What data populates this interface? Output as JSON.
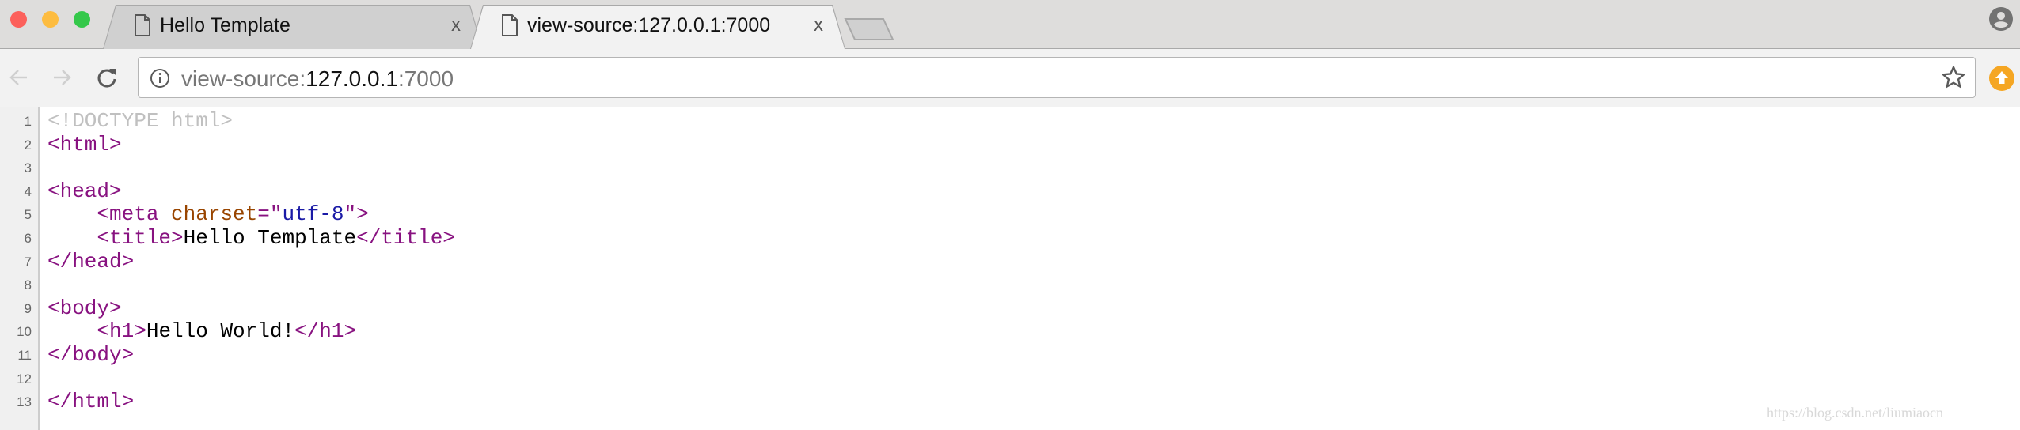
{
  "window": {
    "traffic_lights": {
      "close": "#fc605b",
      "minimize": "#fdbc40",
      "zoom": "#34c84a"
    }
  },
  "tabs": [
    {
      "label": "Hello Template",
      "active": false,
      "close_label": "x"
    },
    {
      "label": "view-source:127.0.0.1:7000",
      "active": true,
      "close_label": "x"
    }
  ],
  "toolbar": {
    "url_prefix": "view-source:",
    "url_host": "127.0.0.1",
    "url_port": ":7000",
    "update_color": "#f5a623"
  },
  "source": {
    "line_numbers": [
      "1",
      "2",
      "3",
      "4",
      "5",
      "6",
      "7",
      "8",
      "9",
      "10",
      "11",
      "12",
      "13"
    ],
    "lines": [
      [
        {
          "t": "doctype",
          "s": "<!DOCTYPE html>"
        }
      ],
      [
        {
          "t": "tag",
          "s": "<html>"
        }
      ],
      [],
      [
        {
          "t": "tag",
          "s": "<head>"
        }
      ],
      [
        {
          "t": "txt",
          "s": "    "
        },
        {
          "t": "tag",
          "s": "<meta "
        },
        {
          "t": "attr",
          "s": "charset"
        },
        {
          "t": "tag",
          "s": "=\""
        },
        {
          "t": "val",
          "s": "utf-8"
        },
        {
          "t": "tag",
          "s": "\">"
        }
      ],
      [
        {
          "t": "txt",
          "s": "    "
        },
        {
          "t": "tag",
          "s": "<title>"
        },
        {
          "t": "txt",
          "s": "Hello Template"
        },
        {
          "t": "tag",
          "s": "</title>"
        }
      ],
      [
        {
          "t": "tag",
          "s": "</head>"
        }
      ],
      [],
      [
        {
          "t": "tag",
          "s": "<body>"
        }
      ],
      [
        {
          "t": "txt",
          "s": "    "
        },
        {
          "t": "tag",
          "s": "<h1>"
        },
        {
          "t": "txt",
          "s": "Hello World!"
        },
        {
          "t": "tag",
          "s": "</h1>"
        }
      ],
      [
        {
          "t": "tag",
          "s": "</body>"
        }
      ],
      [],
      [
        {
          "t": "tag",
          "s": "</html>"
        }
      ]
    ]
  },
  "watermark": "https://blog.csdn.net/liumiaocn"
}
